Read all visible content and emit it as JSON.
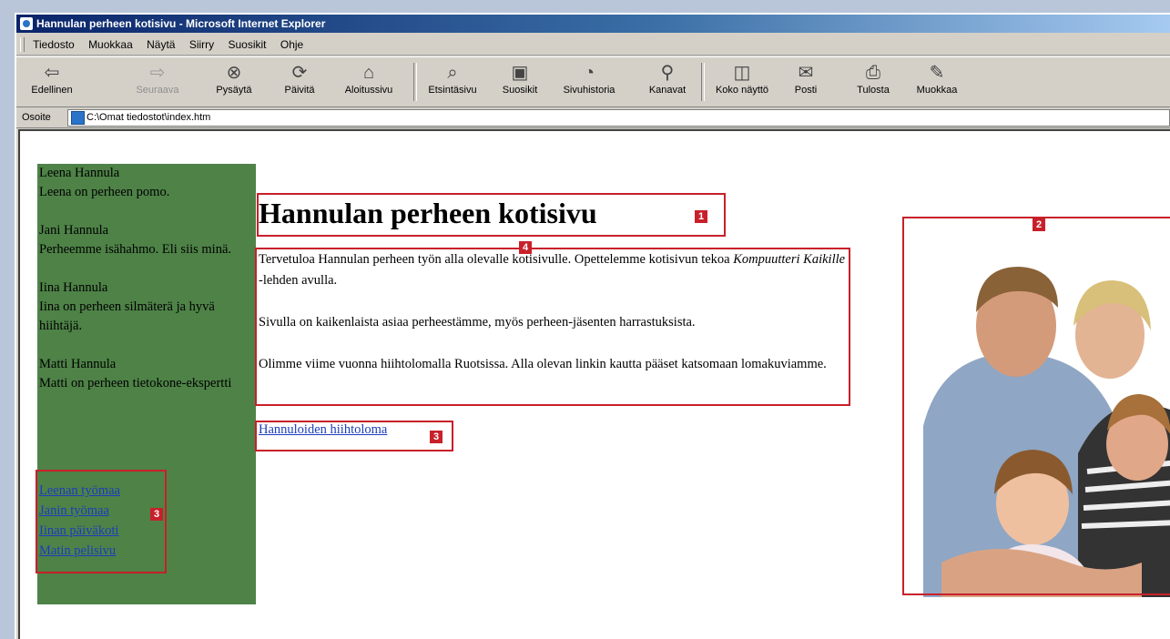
{
  "window": {
    "title": "Hannulan perheen kotisivu - Microsoft Internet Explorer"
  },
  "menu": [
    "Tiedosto",
    "Muokkaa",
    "Näytä",
    "Siirry",
    "Suosikit",
    "Ohje"
  ],
  "toolbar": {
    "back": "Edellinen",
    "forward": "Seuraava",
    "stop": "Pysäytä",
    "refresh": "Päivitä",
    "home": "Aloitussivu",
    "search": "Etsintäsivu",
    "favorites": "Suosikit",
    "history": "Sivuhistoria",
    "channels": "Kanavat",
    "fullscreen": "Koko näyttö",
    "mail": "Posti",
    "print": "Tulosta",
    "edit": "Muokkaa"
  },
  "address": {
    "label": "Osoite",
    "value": "C:\\Omat tiedostot\\index.htm"
  },
  "sidebar": {
    "people": [
      {
        "name": "Leena Hannula",
        "desc": "Leena on perheen pomo."
      },
      {
        "name": "Jani Hannula",
        "desc": "Perheemme isähahmo. Eli siis minä."
      },
      {
        "name": "Iina Hannula",
        "desc": "Iina on perheen silmäterä ja hyvä hiihtäjä."
      },
      {
        "name": "Matti Hannula",
        "desc": "Matti on perheen tietokone-ekspertti"
      }
    ],
    "links": [
      "Leenan työmaa",
      "Janin työmaa",
      "Iinan päiväkoti",
      "Matin pelisivu"
    ]
  },
  "main": {
    "heading": "Hannulan perheen kotisivu",
    "p1_start": "Tervetuloa Hannulan perheen työn alla olevalle kotisivulle. Opettelemme kotisivun tekoa ",
    "p1_italic": "Kompuutteri Kaikille",
    "p1_end": " -lehden avulla.",
    "p2": "Sivulla on kaikenlaista asiaa perheestämme, myös perheen-jäsenten harrastuksista.",
    "p3": "Olimme viime vuonna hiihtolomalla Ruotsissa. Alla olevan linkin kautta pääset katsomaan lomakuviamme.",
    "link": "Hannuloiden hiihtoloma"
  },
  "annotations": {
    "heading_badge": "1",
    "photo_badge": "2",
    "link_badge": "3",
    "sidebar_links_badge": "3",
    "text_badge": "4"
  },
  "colors": {
    "sidebar": "#4e8247",
    "annotation": "#c8202a",
    "link": "#1c3dbb"
  }
}
